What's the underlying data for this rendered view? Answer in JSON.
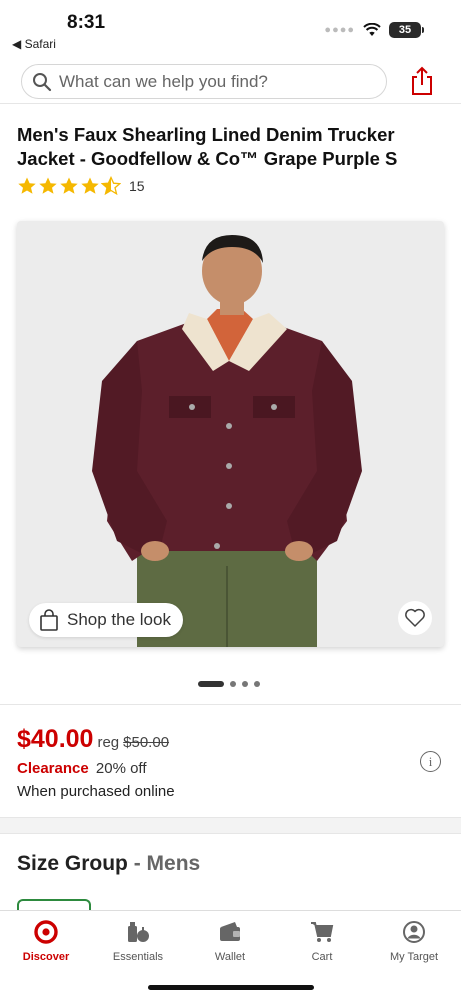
{
  "status_bar": {
    "time": "8:31",
    "back_app": "◀ Safari",
    "battery": "35"
  },
  "search": {
    "placeholder": "What can we help you find?"
  },
  "product": {
    "title": "Men's Faux Shearling Lined Denim Trucker Jacket - Goodfellow & Co™ Grape Purple S",
    "rating": 4.5,
    "rating_count": "15",
    "shop_the_look": "Shop the look",
    "gallery_pages": 4,
    "gallery_active": 0
  },
  "pricing": {
    "current": "$40.00",
    "reg_label": "reg",
    "reg_price": "$50.00",
    "clearance_label": "Clearance",
    "discount": "20% off",
    "note": "When purchased online"
  },
  "size_group": {
    "label": "Size Group",
    "separator": "-",
    "value": "Mens"
  },
  "tabs": [
    {
      "label": "Discover",
      "icon": "target-logo-icon",
      "active": true
    },
    {
      "label": "Essentials",
      "icon": "essentials-icon",
      "active": false
    },
    {
      "label": "Wallet",
      "icon": "wallet-icon",
      "active": false
    },
    {
      "label": "Cart",
      "icon": "cart-icon",
      "active": false
    },
    {
      "label": "My Target",
      "icon": "account-icon",
      "active": false
    }
  ],
  "colors": {
    "brand_red": "#cc0000",
    "jacket_burgundy": "#5c1f2b",
    "chip_green": "#2d8a3e"
  }
}
